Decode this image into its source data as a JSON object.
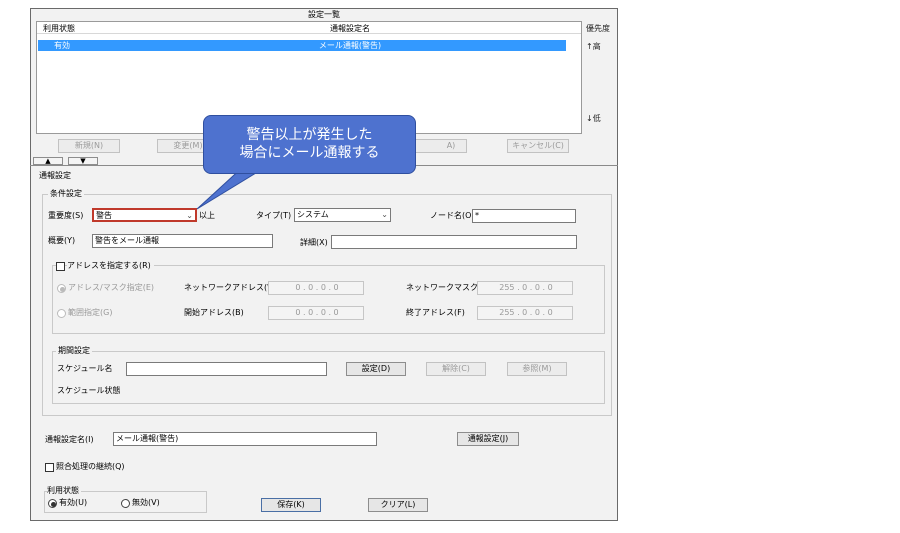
{
  "settings_list": {
    "title": "設定一覧",
    "col_status": "利用状態",
    "col_name": "通報設定名",
    "rows": [
      {
        "status": "有効",
        "name": "メール通報(警告)"
      }
    ],
    "priority_label": "優先度",
    "priority_high": "↑高",
    "priority_low": "↓低",
    "buttons": {
      "new": "新規(N)",
      "change": "変更(M)",
      "hidden_label": "A)",
      "cancel": "キャンセル(C)"
    }
  },
  "callout": {
    "line1": "警告以上が発生した",
    "line2": "場合にメール通報する"
  },
  "notify": {
    "section_title": "通報設定",
    "condition": {
      "title": "条件設定",
      "severity_label": "重要度(S)",
      "severity_value": "警告",
      "severity_suffix": "以上",
      "type_label": "タイプ(T)",
      "type_value": "システム",
      "node_label": "ノード名(O)",
      "node_value": "*",
      "summary_label": "概要(Y)",
      "summary_value": "警告をメール通報",
      "detail_label": "詳細(X)",
      "detail_value": ""
    },
    "address": {
      "check_label": "アドレスを指定する(R)",
      "mask_radio": "アドレス/マスク指定(E)",
      "range_radio": "範囲指定(G)",
      "network_addr_label": "ネットワークアドレス(W)",
      "network_addr_value": [
        "0",
        "0",
        "0",
        "0"
      ],
      "network_mask_label": "ネットワークマスク(P)",
      "network_mask_value": [
        "255",
        "0",
        "0",
        "0"
      ],
      "start_addr_label": "開始アドレス(B)",
      "start_addr_value": [
        "0",
        "0",
        "0",
        "0"
      ],
      "end_addr_label": "終了アドレス(F)",
      "end_addr_value": [
        "255",
        "0",
        "0",
        "0"
      ]
    },
    "period": {
      "title": "期間設定",
      "schedule_name_label": "スケジュール名",
      "schedule_name_value": "",
      "set_button": "設定(D)",
      "release_button": "解除(C)",
      "browse_button": "参照(M)",
      "schedule_status_label": "スケジュール状態"
    },
    "name_label": "通報設定名(I)",
    "name_value": "メール通報(警告)",
    "notify_button": "通報設定(J)",
    "continue_label": "照合処理の継続(Q)",
    "usage": {
      "title": "利用状態",
      "enabled": "有効(U)",
      "disabled": "無効(V)"
    },
    "save_button": "保存(K)",
    "clear_button": "クリア(L)"
  },
  "colors": {
    "selection": "#3399ff",
    "callout": "#4e72cf",
    "severity_border": "#c0392b"
  }
}
